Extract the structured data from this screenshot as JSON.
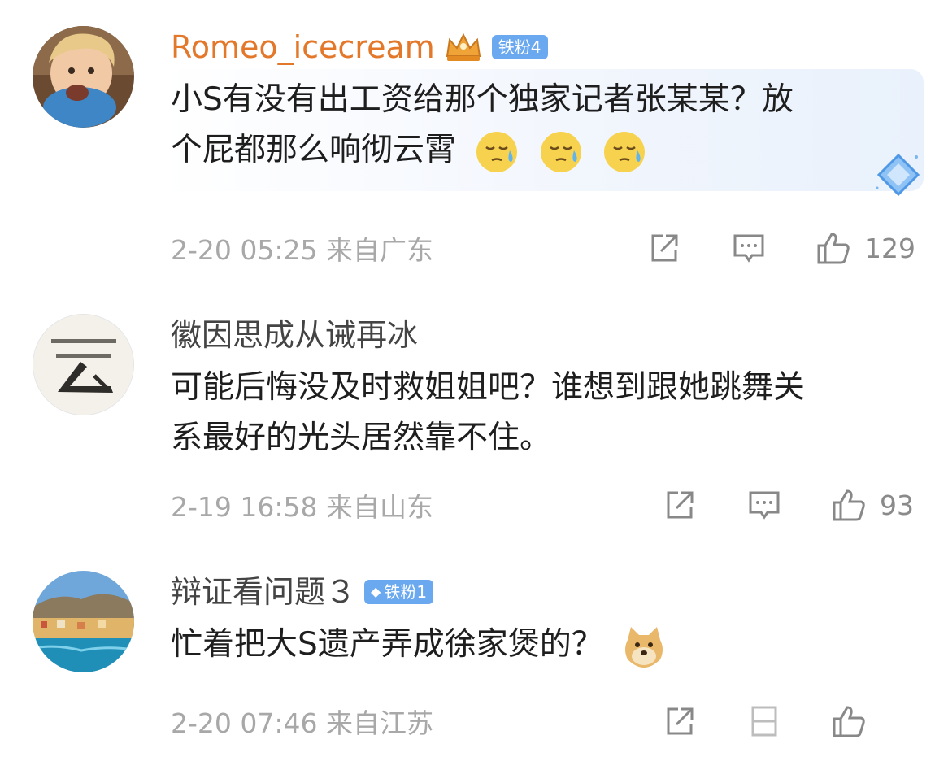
{
  "comments": [
    {
      "username": "Romeo_icecream",
      "badge": "铁粉4",
      "text_line1": "小S有没有出工资给那个独家记者张某某？放",
      "text_line2": "个屁都那么响彻云霄",
      "time": "2-20 05:25",
      "location": "来自广东",
      "likes": "129",
      "emoji": "sweat-face-emoji"
    },
    {
      "username": "徽因思成从诫再冰",
      "text_line1": "可能后悔没及时救姐姐吧？谁想到跟她跳舞关",
      "text_line2": "系最好的光头居然靠不住。",
      "time": "2-19 16:58",
      "location": "来自山东",
      "likes": "93"
    },
    {
      "username": "辩证看问题３",
      "badge": "铁粉1",
      "text_line1": "忙着把大S遗产弄成徐家煲的？",
      "time": "2-20 07:46",
      "location": "来自江苏",
      "likes": ""
    }
  ],
  "colors": {
    "vip_name": "#e3782b",
    "badge_bg": "#6aa9ef",
    "meta_gray": "#a8a8a8",
    "divider": "#e8e8e8"
  },
  "icons": [
    "share-icon",
    "comment-icon",
    "like-icon",
    "crown-icon",
    "diamond-badge-icon"
  ]
}
